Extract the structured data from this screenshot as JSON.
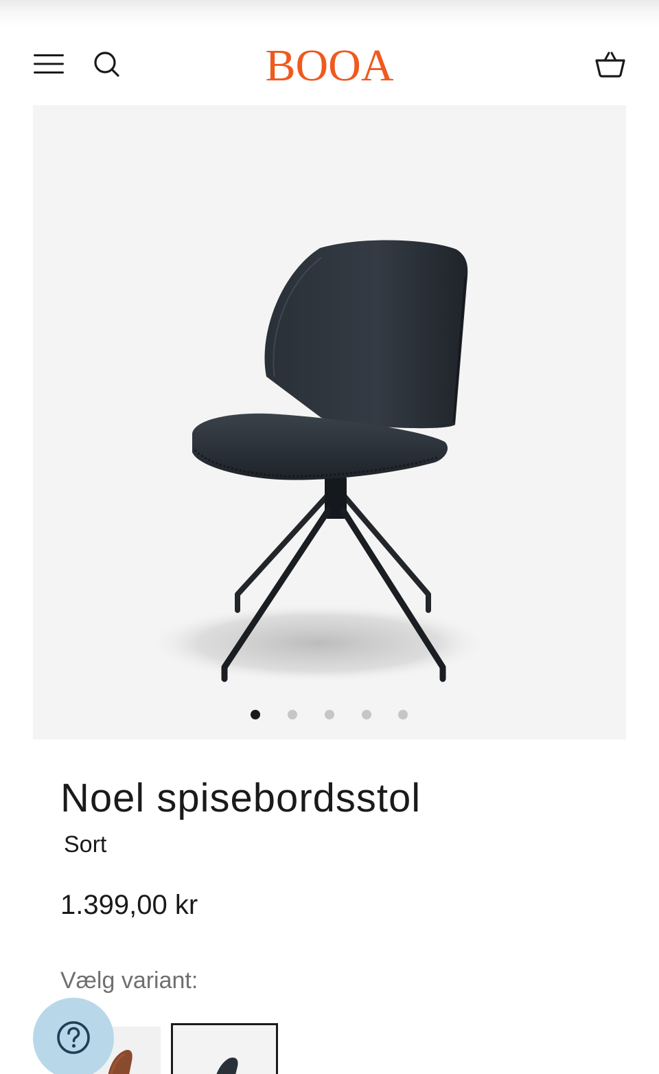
{
  "header": {
    "logo_text": "BOOA",
    "menu_icon": "hamburger-menu-icon",
    "search_icon": "search-icon",
    "cart_icon": "basket-icon"
  },
  "gallery": {
    "image_count": 5,
    "active_index": 0
  },
  "product": {
    "title": "Noel spisebordsstol",
    "color": "Sort",
    "price": "1.399,00 kr"
  },
  "variants": {
    "label": "Vælg variant:",
    "selected_index": 1
  },
  "help": {
    "icon": "question-mark-icon"
  },
  "colors": {
    "brand": "#ef5a1f",
    "help_bubble": "#b8d8ea",
    "text": "#1a1a1a",
    "muted_text": "#6f6f6f"
  }
}
